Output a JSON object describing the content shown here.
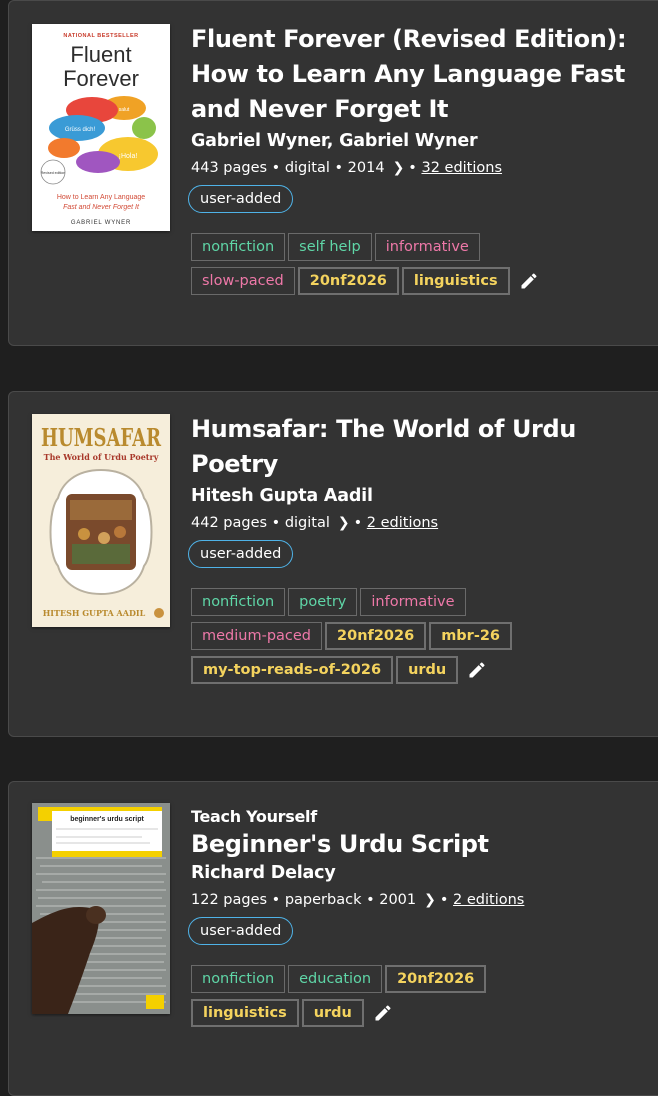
{
  "books": [
    {
      "series": "",
      "title": "Fluent Forever (Revised Edition): How to Learn Any Language Fast and Never Forget It",
      "author": "Gabriel Wyner, Gabriel Wyner",
      "meta_text": "443 pages • digital • 2014",
      "editions_link": "32 editions",
      "badge": "user-added",
      "tags": [
        {
          "label": "nonfiction",
          "style": "green"
        },
        {
          "label": "self help",
          "style": "green"
        },
        {
          "label": "informative",
          "style": "pink"
        },
        {
          "label": "slow-paced",
          "style": "pink"
        },
        {
          "label": "20nf2026",
          "style": "yellow"
        },
        {
          "label": "linguistics",
          "style": "yellow"
        }
      ],
      "cover": {
        "top_label": "NATIONAL BESTSELLER",
        "title_line1": "Fluent",
        "title_line2": "Forever",
        "bubble_words": [
          "¡Hola!",
          "Grüss dich!",
          "salut"
        ],
        "sticker": "Revised edition",
        "subtitle_line1": "How to Learn Any Language",
        "subtitle_line2": "Fast and Never Forget It",
        "author": "GABRIEL WYNER"
      }
    },
    {
      "series": "",
      "title": "Humsafar: The World of Urdu Poetry",
      "author": "Hitesh Gupta Aadil",
      "meta_text": "442 pages • digital",
      "editions_link": "2 editions",
      "badge": "user-added",
      "tags": [
        {
          "label": "nonfiction",
          "style": "green"
        },
        {
          "label": "poetry",
          "style": "green"
        },
        {
          "label": "informative",
          "style": "pink"
        },
        {
          "label": "medium-paced",
          "style": "pink"
        },
        {
          "label": "20nf2026",
          "style": "yellow"
        },
        {
          "label": "mbr-26",
          "style": "yellow"
        },
        {
          "label": "my-top-reads-of-2026",
          "style": "yellow"
        },
        {
          "label": "urdu",
          "style": "yellow"
        }
      ],
      "cover": {
        "title": "HUMSAFAR",
        "subtitle": "The World of Urdu Poetry",
        "author": "HITESH GUPTA AADIL"
      }
    },
    {
      "series": "Teach Yourself",
      "title": "Beginner's Urdu Script",
      "author": "Richard Delacy",
      "meta_text": "122 pages • paperback • 2001",
      "editions_link": "2 editions",
      "badge": "user-added",
      "tags": [
        {
          "label": "nonfiction",
          "style": "green"
        },
        {
          "label": "education",
          "style": "green"
        },
        {
          "label": "20nf2026",
          "style": "yellow"
        },
        {
          "label": "linguistics",
          "style": "yellow"
        },
        {
          "label": "urdu",
          "style": "yellow"
        }
      ],
      "cover": {
        "label": "beginner's urdu script"
      }
    }
  ],
  "colors": {
    "page_bg": "#1f1f1f",
    "card_bg": "#333333",
    "tag_green": "#5fd6a7",
    "tag_pink": "#ee78a8",
    "tag_yellow": "#f4d35e",
    "badge_border": "#4fb3e8"
  },
  "icons": {
    "chevron": "chevron-right-icon",
    "edit": "pencil-icon"
  }
}
